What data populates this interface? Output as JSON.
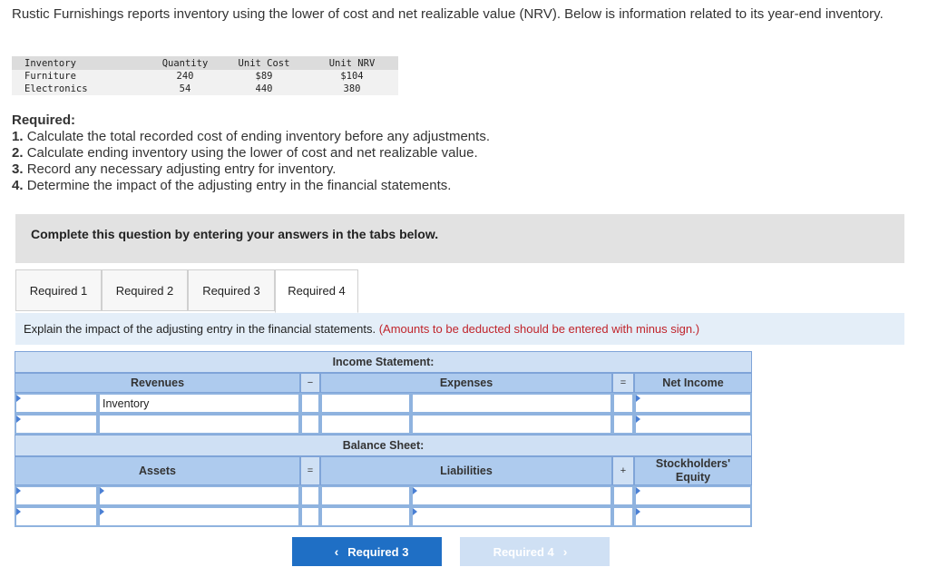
{
  "intro": "Rustic Furnishings reports inventory using the lower of cost and net realizable value (NRV). Below is information related to its year-end inventory.",
  "inventory_table": {
    "headers": [
      "Inventory",
      "Quantity",
      "Unit Cost",
      "Unit NRV"
    ],
    "rows": [
      [
        "Furniture",
        "240",
        "$89",
        "$104"
      ],
      [
        "Electronics",
        "54",
        "440",
        "380"
      ]
    ]
  },
  "required": {
    "heading": "Required:",
    "items": [
      {
        "num": "1.",
        "text": "Calculate the total recorded cost of ending inventory before any adjustments."
      },
      {
        "num": "2.",
        "text": "Calculate ending inventory using the lower of cost and net realizable value."
      },
      {
        "num": "3.",
        "text": "Record any necessary adjusting entry for inventory."
      },
      {
        "num": "4.",
        "text": "Determine the impact of the adjusting entry in the financial statements."
      }
    ]
  },
  "banner": "Complete this question by entering your answers in the tabs below.",
  "tabs": [
    "Required 1",
    "Required 2",
    "Required 3",
    "Required 4"
  ],
  "active_tab": "Required 4",
  "instruction": {
    "main": "Explain the impact of the adjusting entry in the financial statements.",
    "note": "(Amounts to be deducted should be entered with minus sign.)"
  },
  "worksheet": {
    "income_title": "Income Statement:",
    "income_headers": {
      "revenues": "Revenues",
      "minus": "−",
      "expenses": "Expenses",
      "equals": "=",
      "net_income": "Net Income"
    },
    "income_rows": [
      {
        "label": "Inventory"
      },
      {
        "label": ""
      }
    ],
    "balance_title": "Balance Sheet:",
    "balance_headers": {
      "assets": "Assets",
      "equals": "=",
      "liabilities": "Liabilities",
      "plus": "+",
      "equity": "Stockholders' Equity"
    }
  },
  "nav": {
    "prev_label": "Required 3",
    "next_label": "Required 4"
  },
  "colors": {
    "primary_button": "#1f6fc5",
    "header_blue": "#aecbee",
    "note_red": "#c0242b"
  }
}
